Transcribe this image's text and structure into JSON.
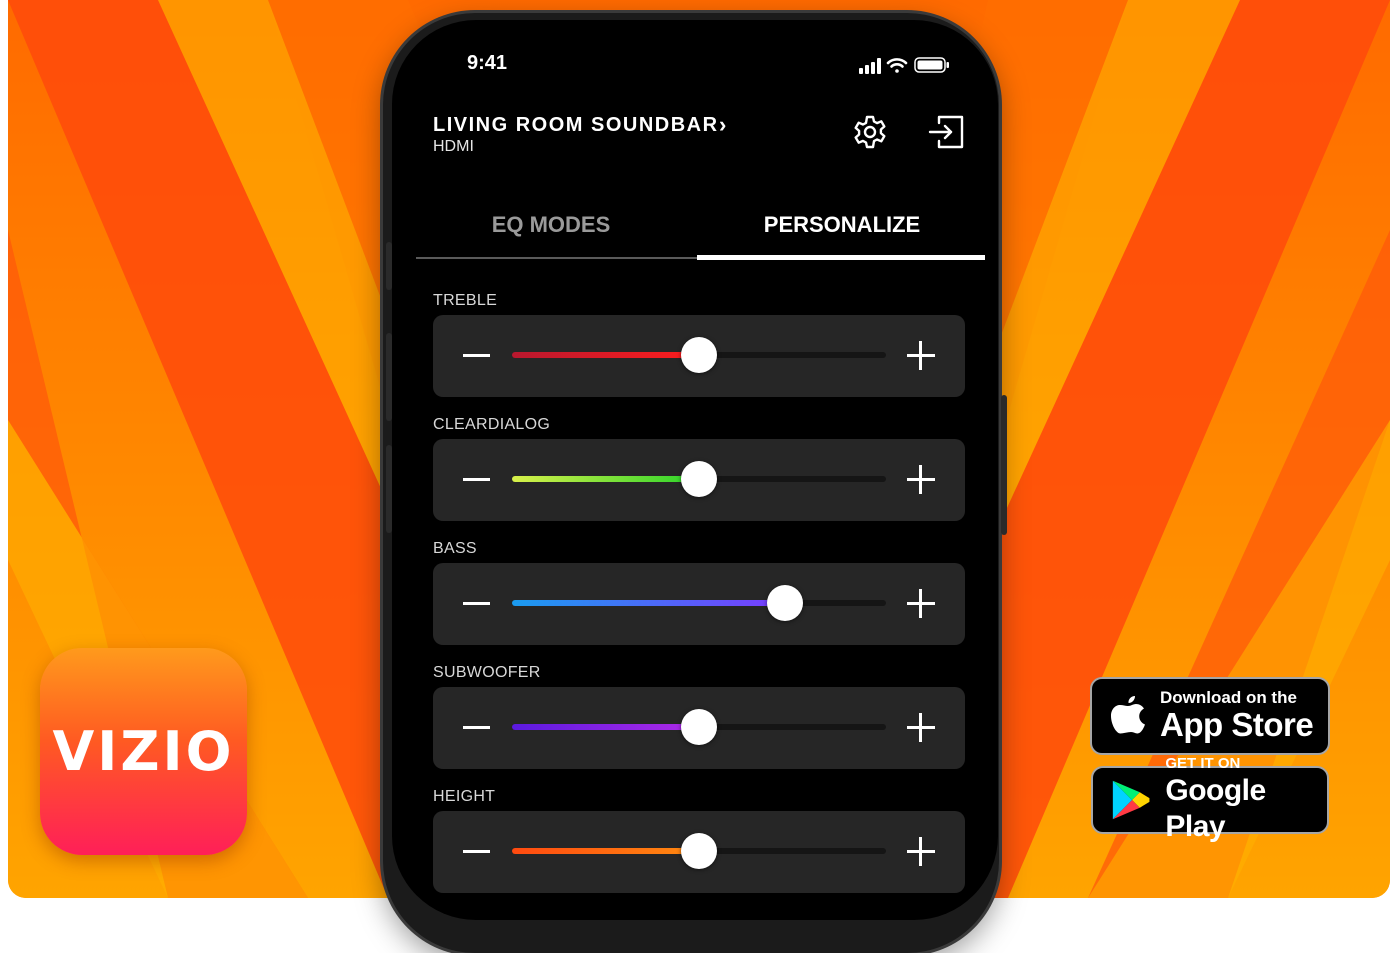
{
  "colors": {
    "background_orange": "#ff8a00",
    "ray_red": "#ff4a0a",
    "ray_yellow": "#ffb000",
    "screen_bg": "#000000",
    "card_bg": "#262626"
  },
  "app_icon": {
    "text": "VIZIO"
  },
  "store_badges": {
    "apple": {
      "small": "Download on the",
      "big": "App Store",
      "icon": "apple-icon"
    },
    "google": {
      "small": "GET IT ON",
      "big": "Google Play",
      "icon": "google-play-icon"
    }
  },
  "status_bar": {
    "time": "9:41",
    "icons": [
      "signal-icon",
      "wifi-icon",
      "battery-icon"
    ]
  },
  "header": {
    "device_name": "LIVING ROOM SOUNDBAR",
    "chevron": "›",
    "input": "HDMI",
    "icons": [
      "gear-icon",
      "exit-icon"
    ]
  },
  "tabs": [
    {
      "label": "EQ MODES",
      "active": false
    },
    {
      "label": "PERSONALIZE",
      "active": true
    }
  ],
  "sliders": [
    {
      "label": "TREBLE",
      "value_fraction": 0.5,
      "gradient": [
        "#b8182e",
        "#ff1d1d"
      ]
    },
    {
      "label": "CLEARDIALOG",
      "value_fraction": 0.5,
      "gradient": [
        "#d8f04a",
        "#2ad42a"
      ]
    },
    {
      "label": "BASS",
      "value_fraction": 0.73,
      "gradient": [
        "#1a9cf0",
        "#7a3bff"
      ]
    },
    {
      "label": "SUBWOOFER",
      "value_fraction": 0.5,
      "gradient": [
        "#5a1ae0",
        "#b02ae8"
      ]
    },
    {
      "label": "HEIGHT",
      "value_fraction": 0.5,
      "gradient": [
        "#ff4a10",
        "#ff8a10"
      ]
    }
  ]
}
